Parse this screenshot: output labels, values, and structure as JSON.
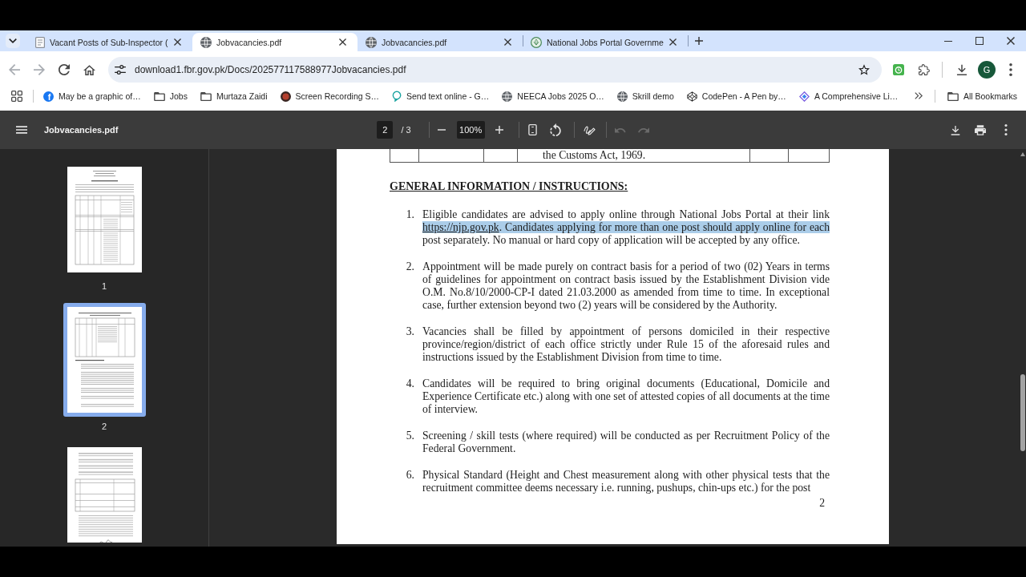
{
  "tab_strip": {
    "tabs": [
      {
        "kind": "document",
        "title": "Vacant Posts of Sub-Inspector (",
        "selected": false
      },
      {
        "kind": "globe",
        "title": "Jobvacancies.pdf",
        "selected": true
      },
      {
        "kind": "globe",
        "title": "Jobvacancies.pdf",
        "selected": false
      },
      {
        "kind": "emblem",
        "title": "National Jobs Portal Governme",
        "selected": false
      }
    ]
  },
  "toolbar": {
    "back": {
      "disabled": true
    },
    "forward": {
      "disabled": true
    },
    "address": "download1.fbr.gov.pk/Docs/202577117588977Jobvacancies.pdf",
    "profile_initial": "G"
  },
  "bookmarks_bar": {
    "items": [
      {
        "kind": "logo",
        "logo_text": "f",
        "label": "May be a graphic of…"
      },
      {
        "kind": "folder",
        "label": "Jobs"
      },
      {
        "kind": "folder",
        "label": "Murtaza Zaidi"
      },
      {
        "kind": "record",
        "label": "Screen Recording S…"
      },
      {
        "kind": "chat",
        "label": "Send text online - G…"
      },
      {
        "kind": "globe",
        "label": "NEECA Jobs 2025 O…"
      },
      {
        "kind": "globe",
        "label": "Skrill demo"
      },
      {
        "kind": "cube",
        "label": "CodePen - A Pen by…"
      },
      {
        "kind": "diamond",
        "label": "A Comprehensive Li…"
      }
    ],
    "all_bookmarks": "All Bookmarks"
  },
  "pdf_viewer": {
    "title": "Jobvacancies.pdf",
    "page_input": {
      "value": "2"
    },
    "page_total": "/ 3",
    "zoom": {
      "value": "100%"
    },
    "undo": {
      "disabled": true
    },
    "redo": {
      "disabled": true
    },
    "thumbnails": [
      {
        "label": "1",
        "selected": false
      },
      {
        "label": "2",
        "selected": true
      },
      {
        "selected": false
      }
    ],
    "page": {
      "table": {
        "rows": [
          {
            "column_4": "the Customs Act, 1969."
          }
        ]
      },
      "heading": "GENERAL INFORMATION / INSTRUCTIONS:",
      "items": [
        {
          "number": "1.",
          "segments": [
            {
              "kind": "text",
              "text": "Eligible candidates are advised to apply online through National Jobs Portal at their link ",
              "highlighted": false
            },
            {
              "kind": "link",
              "text": "https://njp.gov.pk",
              "highlighted": true
            },
            {
              "kind": "text",
              "text": ". Candidates applying for more than one post should apply online for each",
              "highlighted": true
            },
            {
              "kind": "text",
              "text": " post separately. No manual or hard copy of application will be accepted by any office.",
              "highlighted": false
            }
          ]
        },
        {
          "number": "2.",
          "segments": [
            {
              "kind": "text",
              "text": "Appointment will be made purely on contract basis for a period of two (02) Years in terms of guidelines for appointment on contract basis issued by the Establishment Division vide O.M. No.8/10/2000-CP-I dated 21.03.2000 as amended from time to time. In exceptional case, further extension beyond two (2) years will be considered by the Authority.",
              "highlighted": false
            }
          ]
        },
        {
          "number": "3.",
          "segments": [
            {
              "kind": "text",
              "text": "Vacancies shall be filled by appointment of persons domiciled in their respective province/region/district of each office strictly under Rule 15 of the aforesaid rules and instructions issued by the Establishment Division from time to time.",
              "highlighted": false
            }
          ]
        },
        {
          "number": "4.",
          "segments": [
            {
              "kind": "text",
              "text": "Candidates will be required to bring original documents (Educational, Domicile and Experience Certificate etc.) along with one set of attested copies of all documents at the time of interview.",
              "highlighted": false
            }
          ]
        },
        {
          "number": "5.",
          "segments": [
            {
              "kind": "text",
              "text": "Screening / skill tests (where required) will be conducted as per Recruitment Policy of the Federal Government.",
              "highlighted": false
            }
          ]
        },
        {
          "number": "6.",
          "segments": [
            {
              "kind": "text",
              "text": "Physical Standard (Height and Chest measurement along with other physical tests that the recruitment committee deems necessary i.e. running, pushups, chin-ups etc.) for the post",
              "highlighted": false
            }
          ]
        }
      ],
      "page_number": "2"
    }
  }
}
